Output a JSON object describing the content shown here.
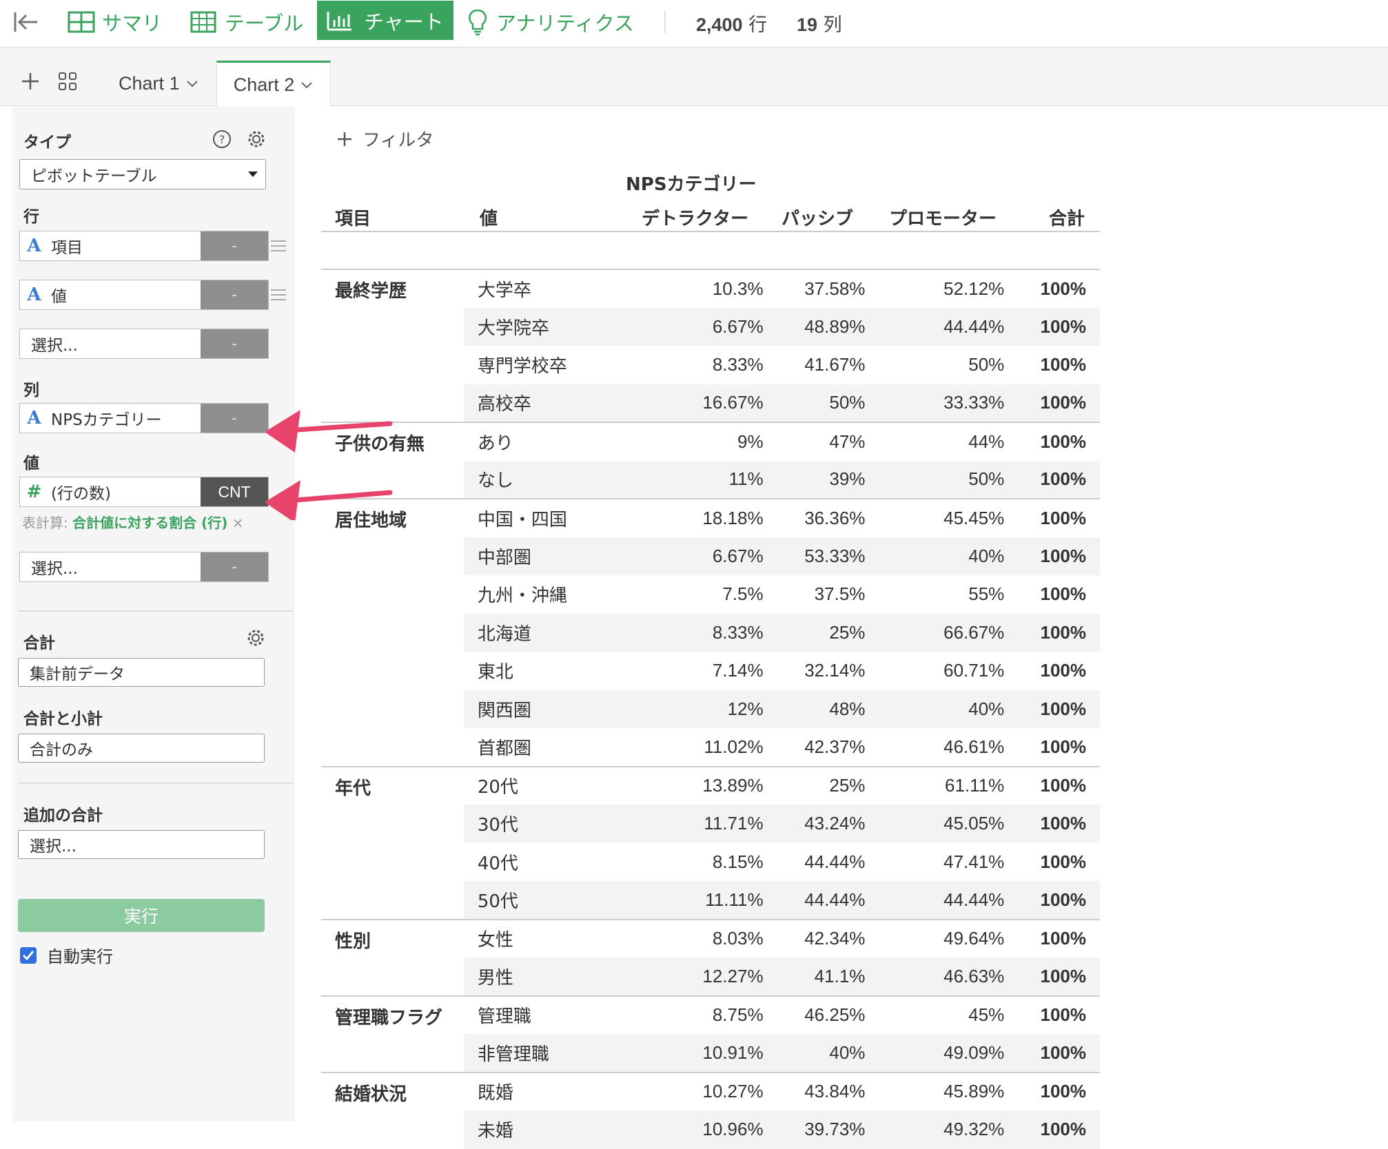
{
  "topbar": {
    "summary": "サマリ",
    "table": "テーブル",
    "chart": "チャート",
    "analytics": "アナリティクス",
    "rows_count": "2,400",
    "rows_unit": "行",
    "cols_count": "19",
    "cols_unit": "列"
  },
  "tabs": {
    "chart1": "Chart 1",
    "chart2": "Chart 2"
  },
  "panel": {
    "type_label": "タイプ",
    "type_value": "ピボットテーブル",
    "rows_label": "行",
    "row1": "項目",
    "row2": "値",
    "row3": "選択...",
    "dash": "-",
    "cols_label": "列",
    "col1": "NPSカテゴリー",
    "vals_label": "値",
    "val1": "(行の数)",
    "val1_agg": "CNT",
    "calc_prefix": "表計算:",
    "calc_value": "合計値に対する割合 (行)",
    "calc_close": "×",
    "val_select": "選択...",
    "total_label": "合計",
    "total_value": "集計前データ",
    "subtotal_label": "合計と小計",
    "subtotal_value": "合計のみ",
    "extra_label": "追加の合計",
    "extra_value": "選択...",
    "run": "実行",
    "auto_run": "自動実行"
  },
  "filter": "フィルタ",
  "pivot": {
    "col_group": "NPSカテゴリー",
    "headers": [
      "項目",
      "値",
      "デトラクター",
      "パッシブ",
      "プロモーター",
      "合計"
    ],
    "groups": [
      {
        "name": "最終学歴",
        "rows": [
          [
            "大学卒",
            "10.3%",
            "37.58%",
            "52.12%",
            "100%"
          ],
          [
            "大学院卒",
            "6.67%",
            "48.89%",
            "44.44%",
            "100%"
          ],
          [
            "専門学校卒",
            "8.33%",
            "41.67%",
            "50%",
            "100%"
          ],
          [
            "高校卒",
            "16.67%",
            "50%",
            "33.33%",
            "100%"
          ]
        ]
      },
      {
        "name": "子供の有無",
        "rows": [
          [
            "あり",
            "9%",
            "47%",
            "44%",
            "100%"
          ],
          [
            "なし",
            "11%",
            "39%",
            "50%",
            "100%"
          ]
        ]
      },
      {
        "name": "居住地域",
        "rows": [
          [
            "中国・四国",
            "18.18%",
            "36.36%",
            "45.45%",
            "100%"
          ],
          [
            "中部圏",
            "6.67%",
            "53.33%",
            "40%",
            "100%"
          ],
          [
            "九州・沖縄",
            "7.5%",
            "37.5%",
            "55%",
            "100%"
          ],
          [
            "北海道",
            "8.33%",
            "25%",
            "66.67%",
            "100%"
          ],
          [
            "東北",
            "7.14%",
            "32.14%",
            "60.71%",
            "100%"
          ],
          [
            "関西圏",
            "12%",
            "48%",
            "40%",
            "100%"
          ],
          [
            "首都圏",
            "11.02%",
            "42.37%",
            "46.61%",
            "100%"
          ]
        ]
      },
      {
        "name": "年代",
        "rows": [
          [
            "20代",
            "13.89%",
            "25%",
            "61.11%",
            "100%"
          ],
          [
            "30代",
            "11.71%",
            "43.24%",
            "45.05%",
            "100%"
          ],
          [
            "40代",
            "8.15%",
            "44.44%",
            "47.41%",
            "100%"
          ],
          [
            "50代",
            "11.11%",
            "44.44%",
            "44.44%",
            "100%"
          ]
        ]
      },
      {
        "name": "性別",
        "rows": [
          [
            "女性",
            "8.03%",
            "42.34%",
            "49.64%",
            "100%"
          ],
          [
            "男性",
            "12.27%",
            "41.1%",
            "46.63%",
            "100%"
          ]
        ]
      },
      {
        "name": "管理職フラグ",
        "rows": [
          [
            "管理職",
            "8.75%",
            "46.25%",
            "45%",
            "100%"
          ],
          [
            "非管理職",
            "10.91%",
            "40%",
            "49.09%",
            "100%"
          ]
        ]
      },
      {
        "name": "結婚状況",
        "rows": [
          [
            "既婚",
            "10.27%",
            "43.84%",
            "45.89%",
            "100%"
          ],
          [
            "未婚",
            "10.96%",
            "39.73%",
            "49.32%",
            "100%"
          ]
        ]
      }
    ]
  },
  "colors": {
    "accent": "#3aa35e",
    "annotation_arrow": "#e8436a",
    "run_button": "#8ccaa0"
  }
}
